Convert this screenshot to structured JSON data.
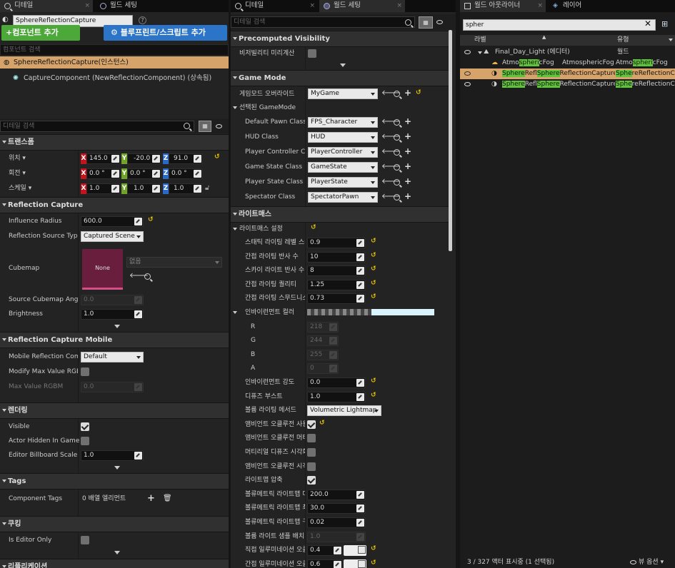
{
  "details": {
    "tab_label": "디테일",
    "tab2_label": "월드 세팅",
    "object_name": "SphereReflectionCapture",
    "add_component_label": "+컴포넌트 추가",
    "blueprint_label": "블루프린트/스크립트 추가",
    "component_search_placeholder": "컴포넌트 검색",
    "components": [
      "SphereReflectionCapture(인스턴스)",
      "CaptureComponent (NewReflectionComponent) (상속됨)"
    ],
    "detail_search_placeholder": "디테일 검색",
    "transform": {
      "header": "트랜스폼",
      "location_label": "위치 ▾",
      "rotation_label": "회전 ▾",
      "scale_label": "스케일 ▾",
      "location": [
        "145.0",
        "-20.0",
        "91.0"
      ],
      "rotation": [
        "0.0 °",
        "0.0 °",
        "0.0 °"
      ],
      "scale": [
        "1.0",
        "1.0",
        "1.0"
      ]
    },
    "reflection_capture": {
      "header": "Reflection Capture",
      "influence_radius_label": "Influence Radius",
      "influence_radius": "600.0",
      "source_type_label": "Reflection Source Type",
      "source_type": "Captured Scene",
      "cubemap_label": "Cubemap",
      "cubemap_thumb": "None",
      "cubemap_value": "없음",
      "source_angle_label": "Source Cubemap Angle",
      "source_angle": "0.0",
      "brightness_label": "Brightness",
      "brightness": "1.0"
    },
    "reflection_mobile": {
      "header": "Reflection Capture Mobile",
      "mobile_label": "Mobile Reflection Com",
      "mobile_value": "Default",
      "modify_max_label": "Modify Max Value RGB",
      "max_value_label": "Max Value RGBM",
      "max_value": "0.0"
    },
    "rendering": {
      "header": "렌더링",
      "visible_label": "Visible",
      "actor_hidden_label": "Actor Hidden In Game",
      "billboard_label": "Editor Billboard Scale",
      "billboard_value": "1.0"
    },
    "tags": {
      "header": "Tags",
      "component_tags_label": "Component Tags",
      "component_tags_value": "0 배열 엘리먼트"
    },
    "cooking": {
      "header": "쿠킹",
      "editor_only_label": "Is Editor Only"
    },
    "replication_header": "리플리케이션"
  },
  "world": {
    "tab_details": "디테일",
    "tab_world": "월드 세팅",
    "search_placeholder": "디테일 검색",
    "precomputed": {
      "header": "Precomputed Visibility",
      "label": "비저빌리티 미리계산"
    },
    "gamemode": {
      "header": "Game Mode",
      "override_label": "게임모드 오버라이드",
      "override_value": "MyGame",
      "selected_label": "선택된 GameMode",
      "items": [
        {
          "label": "Default Pawn Class",
          "value": "FPS_Character"
        },
        {
          "label": "HUD Class",
          "value": "HUD"
        },
        {
          "label": "Player Controller Cla",
          "value": "PlayerController"
        },
        {
          "label": "Game State Class",
          "value": "GameState"
        },
        {
          "label": "Player State Class",
          "value": "PlayerState"
        },
        {
          "label": "Spectator Class",
          "value": "SpectatorPawn"
        }
      ]
    },
    "lightmass": {
      "header": "라이트매스",
      "settings_label": "라이트매스 설정",
      "static_scale_label": "스태틱 라이팅 레벨 스케",
      "static_scale": "0.9",
      "indirect_bounces_label": "간접 라이팅 반사 수",
      "indirect_bounces": "10",
      "sky_bounces_label": "스카이 라이트 반사 수",
      "sky_bounces": "8",
      "indirect_quality_label": "간접 라이팅 퀄리티",
      "indirect_quality": "1.25",
      "smoothness_label": "간접 라이팅 스무드니스",
      "smoothness": "0.73",
      "env_color_label": "인바이런먼트 컬러",
      "r_label": "R",
      "r": "218",
      "g_label": "G",
      "g": "244",
      "b_label": "B",
      "b": "255",
      "a_label": "A",
      "a": "0",
      "env_intensity_label": "인바이런먼트 강도",
      "env_intensity": "0.0",
      "diffuse_boost_label": "디퓨즈 부스트",
      "diffuse_boost": "1.0",
      "volume_method_label": "볼륨 라이팅 메서드",
      "volume_method": "Volumetric Lightmap",
      "ao_use_label": "앰비언트 오클루전 사용",
      "ao_me_label": "앰비언트 오클루전 머티",
      "mat_diffuse_label": "머티리얼 디퓨즈 시각화",
      "ao_vis_label": "앰비언트 오클루전 시각",
      "compress_label": "라이트맵 압축",
      "vol_detail_label": "볼류메트릭 라이트맵 디",
      "vol_detail": "200.0",
      "vol_max_label": "볼류메트릭 라이트맵 최",
      "vol_max": "30.0",
      "vol_sphere_label": "볼류메트릭 라이트맵 구",
      "vol_sphere": "0.02",
      "volume_sample_label": "볼륨 라이트 샘플 배치 :",
      "volume_sample": "1.0",
      "direct_occ_label": "직접 일루미네이션 오클",
      "direct_occ": "0.4",
      "indirect_occ_label": "간접 일루미네이션 오클",
      "indirect_occ": "0.6"
    }
  },
  "outliner": {
    "tab_label": "월드 아웃라이너",
    "tab2_label": "레이어",
    "search_value": "spher",
    "col_label": "라벨",
    "col_type": "유형",
    "rows": [
      {
        "pre": "Final_Day_Light (에디터)",
        "hl": "",
        "post": "",
        "type_pre": "월드",
        "type_hl": "",
        "type_post": ""
      },
      {
        "pre": "Atmo",
        "hl": "spheri",
        "post": "cFog",
        "type_pre": "Atmo",
        "type_hl": "spheri",
        "type_post": "cFog",
        "extra_pre": "AtmosphericFog"
      },
      {
        "pre": "",
        "hl": "Sphere",
        "post": "Refl",
        "hl2": "Sphere",
        "post2": "ReflectionCapture",
        "type_pre": "",
        "type_hl": "Sphe",
        "type_post": "reReflectionC"
      },
      {
        "pre": "",
        "hl": "Sphere",
        "post": "Refl",
        "hl2": "Sphere",
        "post2": "ReflectionCapture",
        "type_pre": "",
        "type_hl": "Sphe",
        "type_post": "reReflectionC"
      }
    ],
    "status": "3 / 327 액터 표시중 (1 선택됨)",
    "view_options": "뷰 옵션"
  },
  "colors": {
    "accent_green": "#5fc43a",
    "selection": "#d6a46b",
    "add_button": "#4ca838",
    "blueprint_button": "#2b74c7",
    "axis_x": "#c7121c",
    "axis_y": "#6fa32a",
    "axis_z": "#2a69c6",
    "reset_yellow": "#e8c300"
  },
  "icons": {
    "tab": "details-icon",
    "world": "globe-icon",
    "search": "search-icon",
    "grid": "grid-icon",
    "eye": "eye-icon",
    "lock": "lock-icon",
    "browse": "browse-icon",
    "plus": "plus-icon",
    "trash": "trash-icon",
    "arrow_left": "arrow-left-icon",
    "reset": "reset-arrow-icon"
  }
}
